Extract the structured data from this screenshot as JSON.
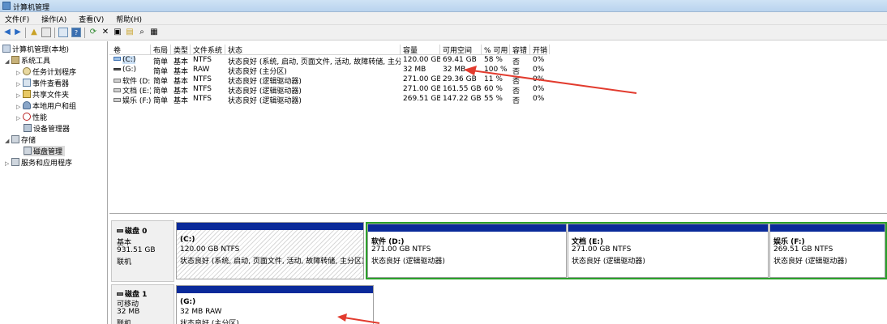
{
  "window": {
    "title": "计算机管理"
  },
  "menu": [
    "文件(F)",
    "操作(A)",
    "查看(V)",
    "帮助(H)"
  ],
  "toolbar_icons": [
    "back-icon",
    "forward-icon",
    "up-icon",
    "show-hide-tree-icon",
    "properties-icon",
    "help-icon",
    "refresh-icon",
    "delete-icon",
    "export-icon",
    "open-icon",
    "search-icon",
    "disk-icon"
  ],
  "tree": {
    "root": "计算机管理(本地)",
    "system_tools": "系统工具",
    "task_scheduler": "任务计划程序",
    "event_viewer": "事件查看器",
    "shared_folders": "共享文件夹",
    "local_users": "本地用户和组",
    "performance": "性能",
    "device_manager": "设备管理器",
    "storage": "存储",
    "disk_management": "磁盘管理",
    "services_apps": "服务和应用程序"
  },
  "columns": [
    "卷",
    "布局",
    "类型",
    "文件系统",
    "状态",
    "容量",
    "可用空间",
    "% 可用",
    "容错",
    "开销"
  ],
  "volumes": [
    {
      "name": "(C:)",
      "layout": "简单",
      "type": "基本",
      "fs": "NTFS",
      "status": "状态良好 (系统, 启动, 页面文件, 活动, 故障转储, 主分区)",
      "capacity": "120.00 GB",
      "free": "69.41 GB",
      "pct": "58 %",
      "fault": "否",
      "overhead": "0%"
    },
    {
      "name": "(G:)",
      "layout": "简单",
      "type": "基本",
      "fs": "RAW",
      "status": "状态良好 (主分区)",
      "capacity": "32 MB",
      "free": "32 MB",
      "pct": "100 %",
      "fault": "否",
      "overhead": "0%"
    },
    {
      "name": "软件 (D:)",
      "layout": "简单",
      "type": "基本",
      "fs": "NTFS",
      "status": "状态良好 (逻辑驱动器)",
      "capacity": "271.00 GB",
      "free": "29.36 GB",
      "pct": "11 %",
      "fault": "否",
      "overhead": "0%"
    },
    {
      "name": "文档 (E:)",
      "layout": "简单",
      "type": "基本",
      "fs": "NTFS",
      "status": "状态良好 (逻辑驱动器)",
      "capacity": "271.00 GB",
      "free": "161.55 GB",
      "pct": "60 %",
      "fault": "否",
      "overhead": "0%"
    },
    {
      "name": "娱乐 (F:)",
      "layout": "简单",
      "type": "基本",
      "fs": "NTFS",
      "status": "状态良好 (逻辑驱动器)",
      "capacity": "269.51 GB",
      "free": "147.22 GB",
      "pct": "55 %",
      "fault": "否",
      "overhead": "0%"
    }
  ],
  "disk0": {
    "label": "磁盘 0",
    "type": "基本",
    "size": "931.51 GB",
    "state": "联机",
    "partitions": [
      {
        "title": "(C:)",
        "size": "120.00 GB NTFS",
        "status": "状态良好 (系统, 启动, 页面文件, 活动, 故障转储, 主分区)"
      },
      {
        "title": "软件  (D:)",
        "size": "271.00 GB NTFS",
        "status": "状态良好 (逻辑驱动器)"
      },
      {
        "title": "文档  (E:)",
        "size": "271.00 GB NTFS",
        "status": "状态良好 (逻辑驱动器)"
      },
      {
        "title": "娱乐  (F:)",
        "size": "269.51 GB NTFS",
        "status": "状态良好 (逻辑驱动器)"
      }
    ]
  },
  "disk1": {
    "label": "磁盘 1",
    "type": "可移动",
    "size": "32 MB",
    "state": "联机",
    "partition": {
      "title": "(G:)",
      "size": "32 MB RAW",
      "status": "状态良好 (主分区)"
    }
  },
  "colors": {
    "partition_bar": "#0a2a9a",
    "selected_border": "#2aa12a",
    "annotation_arrow": "#e23b2e"
  }
}
